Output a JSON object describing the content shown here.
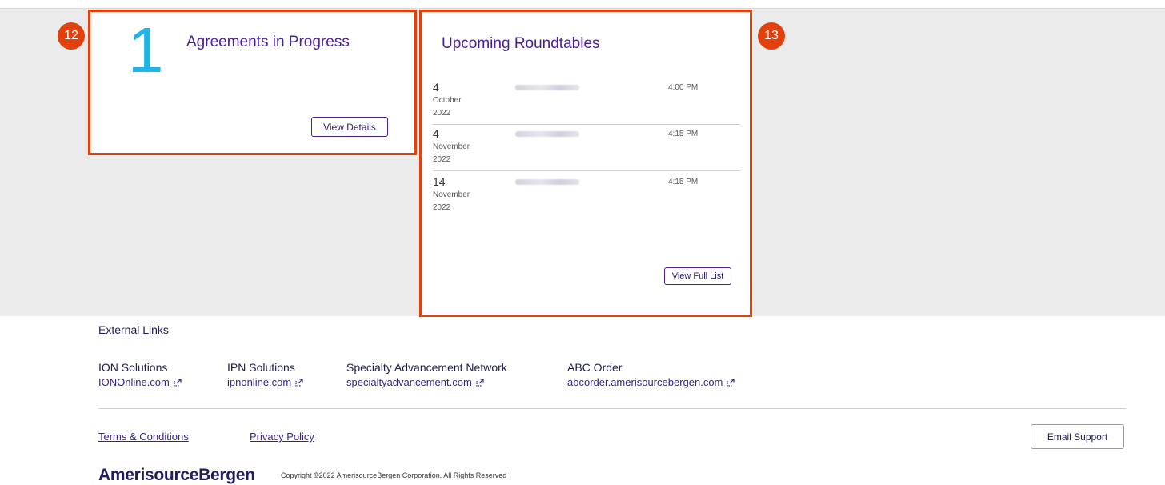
{
  "callouts": {
    "left": "12",
    "right": "13"
  },
  "agreements_card": {
    "count": "1",
    "title": "Agreements in Progress",
    "button_label": "View Details"
  },
  "roundtables_card": {
    "title": "Upcoming Roundtables",
    "rows": [
      {
        "day": "4",
        "month": "October",
        "year": "2022",
        "time": "4:00 PM"
      },
      {
        "day": "4",
        "month": "November",
        "year": "2022",
        "time": "4:15 PM"
      },
      {
        "day": "14",
        "month": "November",
        "year": "2022",
        "time": "4:15 PM"
      }
    ],
    "button_label": "View Full List"
  },
  "external_links": {
    "heading": "External Links",
    "items": [
      {
        "name": "ION Solutions",
        "link": "IONOnline.com"
      },
      {
        "name": "IPN Solutions",
        "link": "ipnonline.com"
      },
      {
        "name": "Specialty Advancement Network",
        "link": "specialtyadvancement.com"
      },
      {
        "name": "ABC Order",
        "link": "abcorder.amerisourcebergen.com"
      }
    ]
  },
  "footer": {
    "terms_label": "Terms & Conditions",
    "privacy_label": "Privacy Policy",
    "email_support_label": "Email Support",
    "logo_text": "AmerisourceBergen",
    "copyright": "Copyright ©2022 AmerisourceBergen Corporation. All Rights Reserved"
  },
  "colors": {
    "accent_purple": "#4a1d96",
    "highlight_red": "#e2400d",
    "count_blue": "#21b4e8"
  }
}
